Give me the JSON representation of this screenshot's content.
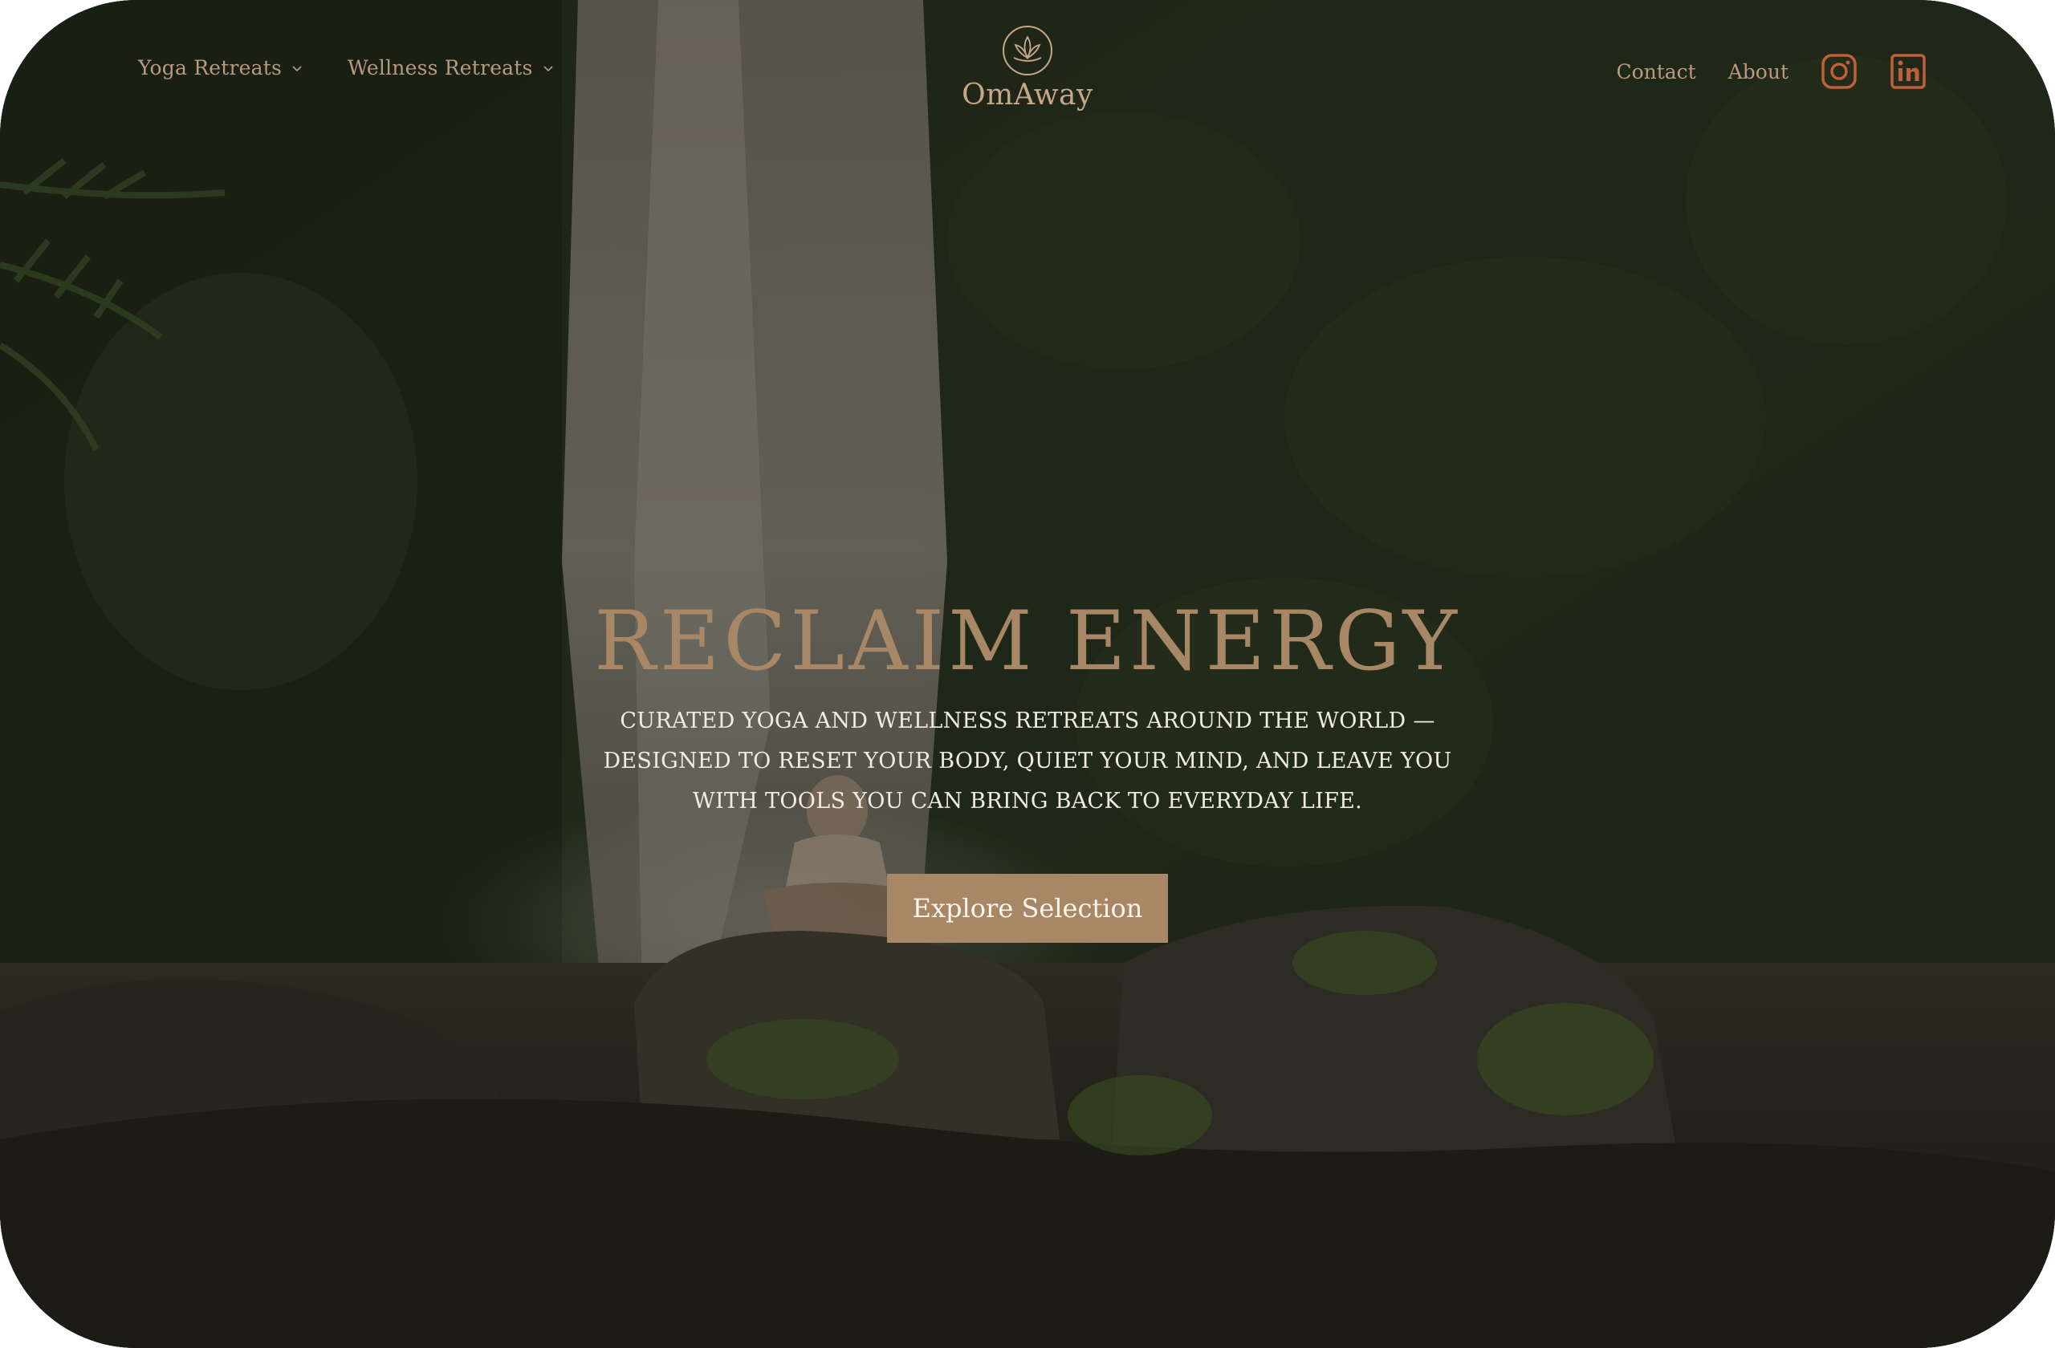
{
  "brand": {
    "name": "OmAway"
  },
  "nav": {
    "left": [
      {
        "label": "Yoga Retreats",
        "icon": "chevron-down-icon"
      },
      {
        "label": "Wellness Retreats",
        "icon": "chevron-down-icon"
      }
    ],
    "right": [
      {
        "label": "Contact"
      },
      {
        "label": "About"
      }
    ],
    "social": [
      "instagram-icon",
      "linkedin-icon"
    ]
  },
  "hero": {
    "title": "RECLAIM ENERGY",
    "subtitle": "CURATED YOGA AND WELLNESS RETREATS AROUND THE WORLD — DESIGNED TO RESET YOUR BODY, QUIET YOUR MIND, AND LEAVE YOU WITH TOOLS YOU CAN BRING BACK TO EVERYDAY LIFE.",
    "cta_label": "Explore Selection"
  },
  "colors": {
    "accent": "#a88766",
    "nav_text": "#b89a7c",
    "social_icon": "#c0603a",
    "hero_text": "#f1ebe2"
  }
}
